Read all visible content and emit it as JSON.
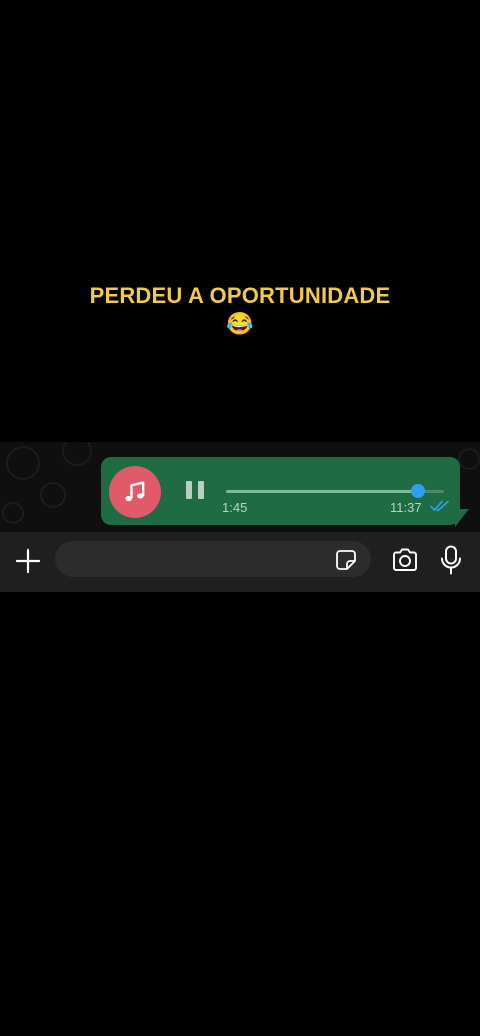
{
  "caption": {
    "text": "PERDEU A OPORTUNIDADE",
    "emoji": "😂"
  },
  "voice_message": {
    "avatar_icon": "music-note-icon",
    "avatar_color": "#e15a6a",
    "bubble_color": "#1f6b43",
    "state": "playing",
    "control_icon": "pause-icon",
    "playback_progress": 0.88,
    "duration": "1:45",
    "sent_time": "11:37",
    "read_status_icon": "double-check-icon",
    "read_color": "#2fa0f0"
  },
  "composer": {
    "attach_icon": "plus-icon",
    "input_value": "",
    "input_placeholder": "",
    "sticker_icon": "sticker-icon",
    "camera_icon": "camera-icon",
    "mic_icon": "microphone-icon"
  }
}
